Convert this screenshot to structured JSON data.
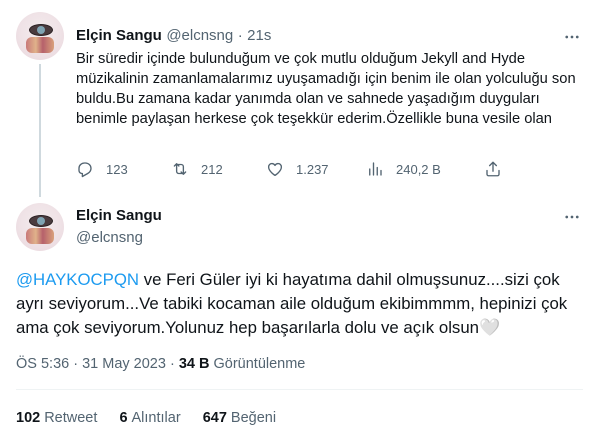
{
  "tweet1": {
    "author_name": "Elçin Sangu",
    "author_handle": "@elcnsng",
    "separator": "·",
    "time": "21s",
    "text": "Bir süredir içinde bulunduğum ve çok mutlu olduğum Jekyll and Hyde müzikalinin zamanlamalarımız uyuşamadığı için benim ile olan yolculuğu son buldu.Bu zamana kadar yanımda olan ve sahnede yaşadığım duyguları benimle paylaşan herkese çok teşekkür ederim.Özellikle buna vesile olan",
    "actions": {
      "replies": "123",
      "retweets": "212",
      "likes": "1.237",
      "views": "240,2 B"
    },
    "icons": [
      "reply-icon",
      "retweet-icon",
      "like-icon",
      "views-icon",
      "share-icon",
      "more-icon"
    ]
  },
  "tweet2": {
    "author_name": "Elçin Sangu",
    "author_handle": "@elcnsng",
    "mention": "@HAYKOCPQN",
    "text": " ve Feri Güler iyi ki hayatıma dahil olmuşsunuz....sizi çok ayrı seviyorum...Ve tabiki kocaman aile olduğum ekibimmmm, hepinizi çok ama çok seviyorum.Yolunuz hep başarılarla dolu ve açık olsun",
    "emoji": "🤍",
    "timestamp": "ÖS 5:36 · 31 May 2023",
    "meta_separator": " · ",
    "views_count": "34 B",
    "views_label": "Görüntülenme"
  },
  "stats": {
    "retweets_count": "102",
    "retweets_label": "Retweet",
    "quotes_count": "6",
    "quotes_label": "Alıntılar",
    "likes_count": "647",
    "likes_label": "Beğeni"
  },
  "colors": {
    "text": "#0f1419",
    "muted": "#536471",
    "link": "#1d9bf0",
    "divider": "#eff3f4"
  }
}
